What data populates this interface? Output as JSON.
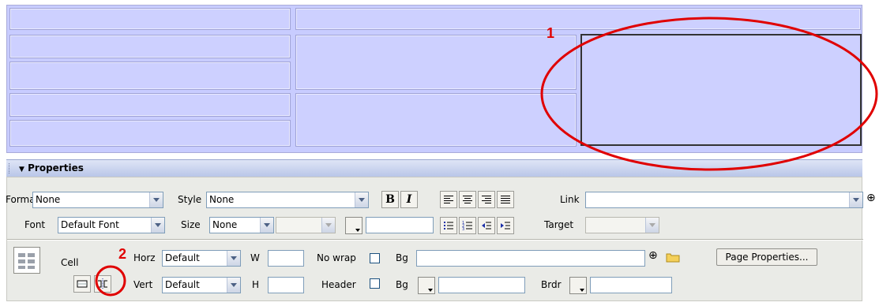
{
  "annotations": {
    "one": "1",
    "two": "2"
  },
  "properties": {
    "title": "Properties",
    "row1": {
      "format_label": "Format",
      "format_value": "None",
      "style_label": "Style",
      "style_value": "None",
      "bold_label": "B",
      "italic_label": "I",
      "link_label": "Link",
      "link_value": ""
    },
    "row2": {
      "font_label": "Font",
      "font_value": "Default Font",
      "size_label": "Size",
      "size_value": "None",
      "size_unit_value": "",
      "target_label": "Target",
      "target_value": ""
    },
    "cell_section": {
      "cell_label": "Cell",
      "horz_label": "Horz",
      "horz_value": "Default",
      "vert_label": "Vert",
      "vert_value": "Default",
      "w_label": "W",
      "h_label": "H",
      "nowrap_label": "No wrap",
      "header_label": "Header",
      "bg_label": "Bg",
      "bg2_label": "Bg",
      "brdr_label": "Brdr",
      "page_properties_label": "Page Properties..."
    }
  },
  "colors": {
    "table_bg": "#cdd0ff",
    "annotation": "#e00000",
    "panel_bg": "#eaebe7"
  }
}
